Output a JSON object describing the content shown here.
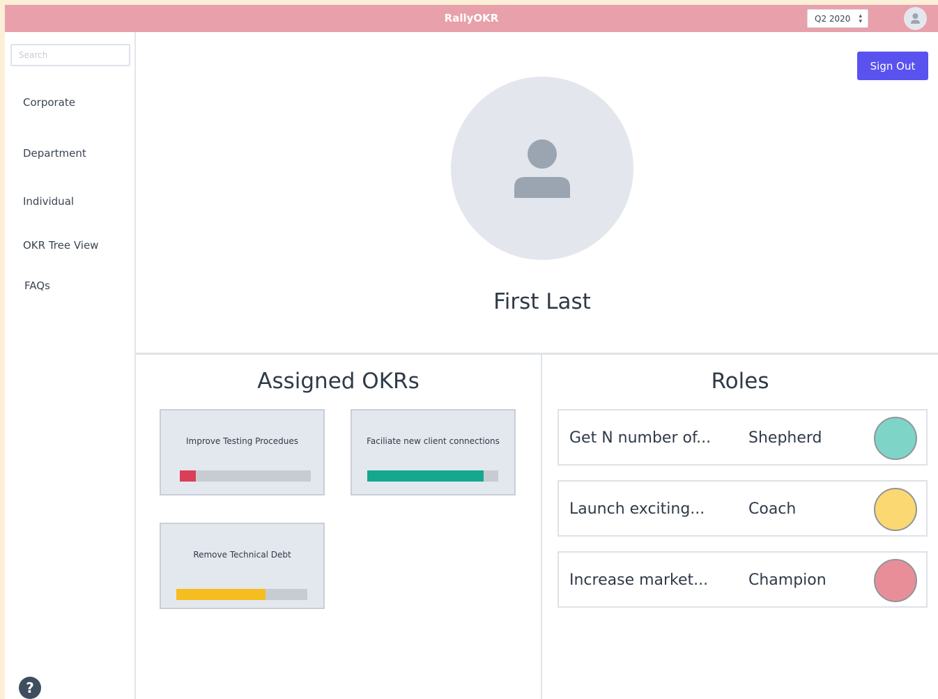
{
  "header": {
    "app_title": "RallyOKR",
    "quarter": "Q2 2020"
  },
  "sidebar": {
    "search_placeholder": "Search",
    "items": [
      {
        "label": "Corporate"
      },
      {
        "label": "Department"
      },
      {
        "label": "Individual"
      },
      {
        "label": "OKR Tree View"
      },
      {
        "label": "FAQs"
      }
    ],
    "help_label": "?"
  },
  "profile": {
    "sign_out_label": "Sign Out",
    "name": "First Last"
  },
  "assigned_okrs": {
    "title": "Assigned OKRs",
    "cards": [
      {
        "label": "Improve Testing Procedues",
        "progress": 0.12,
        "color": "#d93f57"
      },
      {
        "label": "Faciliate new client connections",
        "progress": 0.89,
        "color": "#16a78f"
      },
      {
        "label": "Remove Technical Debt",
        "progress": 0.68,
        "color": "#f5bd1f"
      }
    ]
  },
  "roles": {
    "title": "Roles",
    "items": [
      {
        "okr": "Get N number of...",
        "role": "Shepherd",
        "color": "#7fd4c8"
      },
      {
        "okr": "Launch exciting...",
        "role": "Coach",
        "color": "#fbd872"
      },
      {
        "okr": "Increase market...",
        "role": "Champion",
        "color": "#e88e98"
      }
    ]
  },
  "colors": {
    "topbar": "#e8a0ab",
    "sign_out": "#5a52ef",
    "avatar_bg": "#e3e7ed",
    "avatar_fg": "#9aa5b1"
  },
  "icons": {
    "avatar_small": "user-icon",
    "avatar_large": "user-icon",
    "help": "question-icon",
    "quarter_arrows": "sort-arrows-icon"
  }
}
